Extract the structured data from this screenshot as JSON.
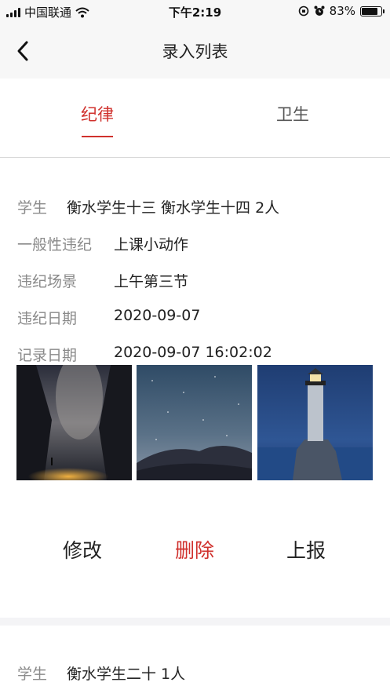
{
  "status_bar": {
    "carrier": "中国联通",
    "time": "下午2:19",
    "battery": "83%",
    "battery_level": 0.83
  },
  "nav": {
    "title": "录入列表",
    "back_icon": "chevron-left-icon"
  },
  "tabs": [
    {
      "label": "纪律",
      "active": true
    },
    {
      "label": "卫生",
      "active": false
    }
  ],
  "records": [
    {
      "fields": [
        {
          "label": "学生",
          "value": "衡水学生十三 衡水学生十四  2人"
        },
        {
          "label": "一般性违纪",
          "value": "上课小动作"
        },
        {
          "label": "违纪场景",
          "value": "上午第三节"
        },
        {
          "label": "违纪日期",
          "value": "2020-09-07"
        },
        {
          "label": "记录日期",
          "value": "2020-09-07 16:02:02"
        }
      ],
      "photos": [
        "milky-way-canyon-photo",
        "desert-night-sky-photo",
        "lighthouse-night-photo"
      ],
      "actions": {
        "edit": "修改",
        "delete": "删除",
        "report": "上报"
      }
    },
    {
      "fields": [
        {
          "label": "学生",
          "value": "衡水学生二十  1人"
        }
      ]
    }
  ],
  "colors": {
    "accent": "#d0312d",
    "label": "#8a8a8a",
    "text": "#222222",
    "nav_bg": "#f7f7f7"
  }
}
